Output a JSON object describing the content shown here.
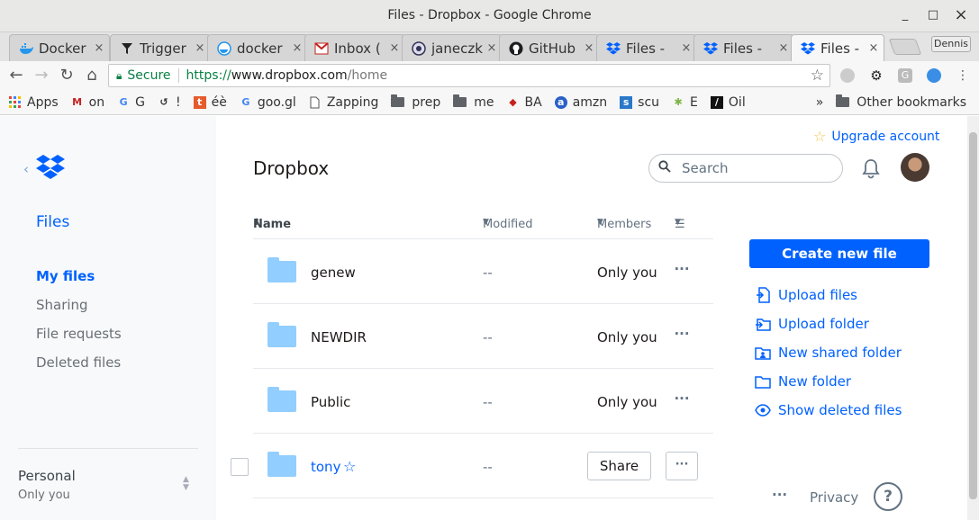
{
  "window": {
    "title": "Files - Dropbox - Google Chrome",
    "minimize": "_",
    "maximize": "□",
    "close": "×"
  },
  "tabs": [
    {
      "label": "Docker",
      "icon": "docker-icon"
    },
    {
      "label": "Trigger",
      "icon": "filter-icon"
    },
    {
      "label": "docker",
      "icon": "docker-icon"
    },
    {
      "label": "Inbox (",
      "icon": "gmail-icon"
    },
    {
      "label": "janeczk",
      "icon": "jenkins-icon"
    },
    {
      "label": "GitHub",
      "icon": "github-icon"
    },
    {
      "label": "Files - ",
      "icon": "dropbox-icon"
    },
    {
      "label": "Files - ",
      "icon": "dropbox-icon"
    },
    {
      "label": "Files - ",
      "icon": "dropbox-icon",
      "active": true
    }
  ],
  "tab_close": "×",
  "profile_name": "Dennis",
  "omnibox": {
    "secure_label": "Secure",
    "url_scheme": "https://",
    "url_host": "www.dropbox.com",
    "url_path": "/home"
  },
  "bookmarks": [
    {
      "label": "Apps",
      "icon": "apps-grid-icon"
    },
    {
      "label": "on",
      "icon": "gmail-icon"
    },
    {
      "label": "G",
      "icon": "google-icon"
    },
    {
      "label": "!",
      "icon": "history-icon"
    },
    {
      "label": "éè",
      "icon": "t-icon"
    },
    {
      "label": "goo.gl",
      "icon": "google-icon"
    },
    {
      "label": "Zapping",
      "icon": "page-icon"
    },
    {
      "label": "prep",
      "icon": "folder-icon"
    },
    {
      "label": "me",
      "icon": "folder-icon"
    },
    {
      "label": "BA",
      "icon": "ba-icon"
    },
    {
      "label": "amzn",
      "icon": "amzn-icon"
    },
    {
      "label": "scu",
      "icon": "scu-icon"
    },
    {
      "label": "E",
      "icon": "e-icon"
    },
    {
      "label": "Oil",
      "icon": "oil-icon"
    }
  ],
  "bookmarks_overflow": "»",
  "other_bookmarks": "Other bookmarks",
  "sidebar": {
    "section": "Files",
    "nav": [
      {
        "label": "My files",
        "active": true
      },
      {
        "label": "Sharing"
      },
      {
        "label": "File requests"
      },
      {
        "label": "Deleted files"
      }
    ],
    "account_name": "Personal",
    "account_sub": "Only you"
  },
  "header": {
    "upgrade": "Upgrade account",
    "title": "Dropbox",
    "search_placeholder": "Search"
  },
  "table": {
    "col_name": "Name",
    "col_modified": "Modified",
    "col_members": "Members",
    "rows": [
      {
        "name": "genew",
        "modified": "--",
        "members": "Only you"
      },
      {
        "name": "NEWDIR",
        "modified": "--",
        "members": "Only you"
      },
      {
        "name": "Public",
        "modified": "--",
        "members": "Only you"
      },
      {
        "name": "tony",
        "modified": "--",
        "share": "Share",
        "starred": true,
        "hovered": true
      }
    ],
    "more": "···"
  },
  "actions": {
    "create": "Create new file",
    "items": [
      {
        "label": "Upload files",
        "icon": "upload-file-icon"
      },
      {
        "label": "Upload folder",
        "icon": "upload-folder-icon"
      },
      {
        "label": "New shared folder",
        "icon": "shared-folder-icon"
      },
      {
        "label": "New folder",
        "icon": "new-folder-icon"
      },
      {
        "label": "Show deleted files",
        "icon": "eye-icon"
      }
    ]
  },
  "footer": {
    "more": "···",
    "privacy": "Privacy",
    "help": "?"
  },
  "colors": {
    "brand": "#0061fe",
    "folder": "#92ceff",
    "secure": "#0b8043"
  }
}
